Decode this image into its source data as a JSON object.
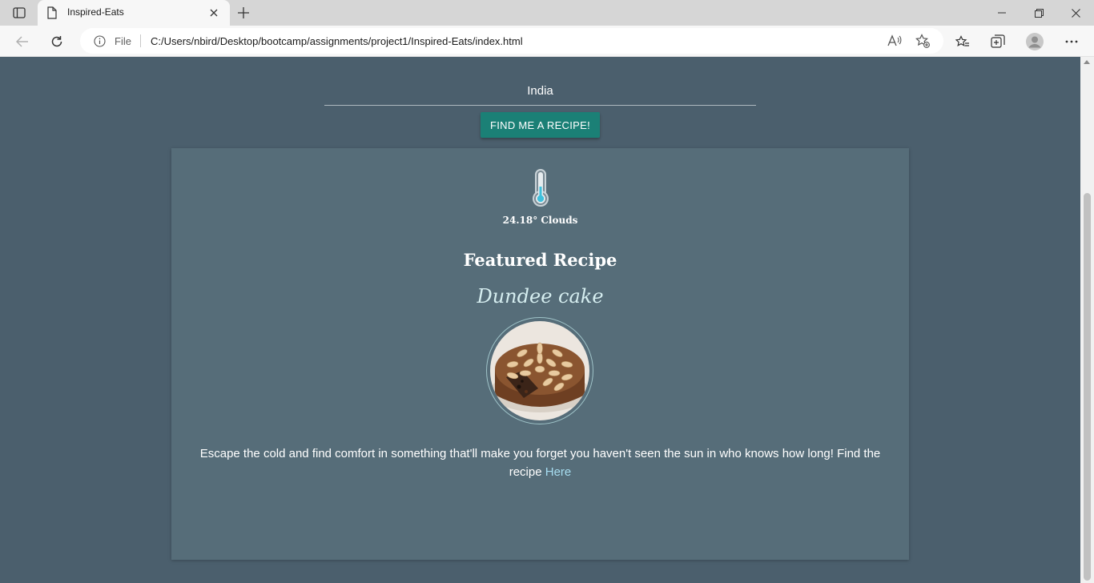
{
  "browser": {
    "tab_title": "Inspired-Eats",
    "file_label": "File",
    "url": "C:/Users/nbird/Desktop/bootcamp/assignments/project1/Inspired-Eats/index.html"
  },
  "search": {
    "country_value": "India",
    "button_label": "FIND ME A RECIPE!"
  },
  "weather": {
    "text": "24.18° Clouds"
  },
  "featured": {
    "title": "Featured Recipe",
    "recipe_name": "Dundee cake",
    "description": "Escape the cold and find comfort in something that'll make you forget you haven't seen the sun in who knows how long! Find the recipe ",
    "link_label": "Here"
  },
  "colors": {
    "page_bg": "#4b5f6d",
    "card_bg": "#566d79",
    "button_bg": "#1b8076",
    "link": "#a6ddf0"
  }
}
